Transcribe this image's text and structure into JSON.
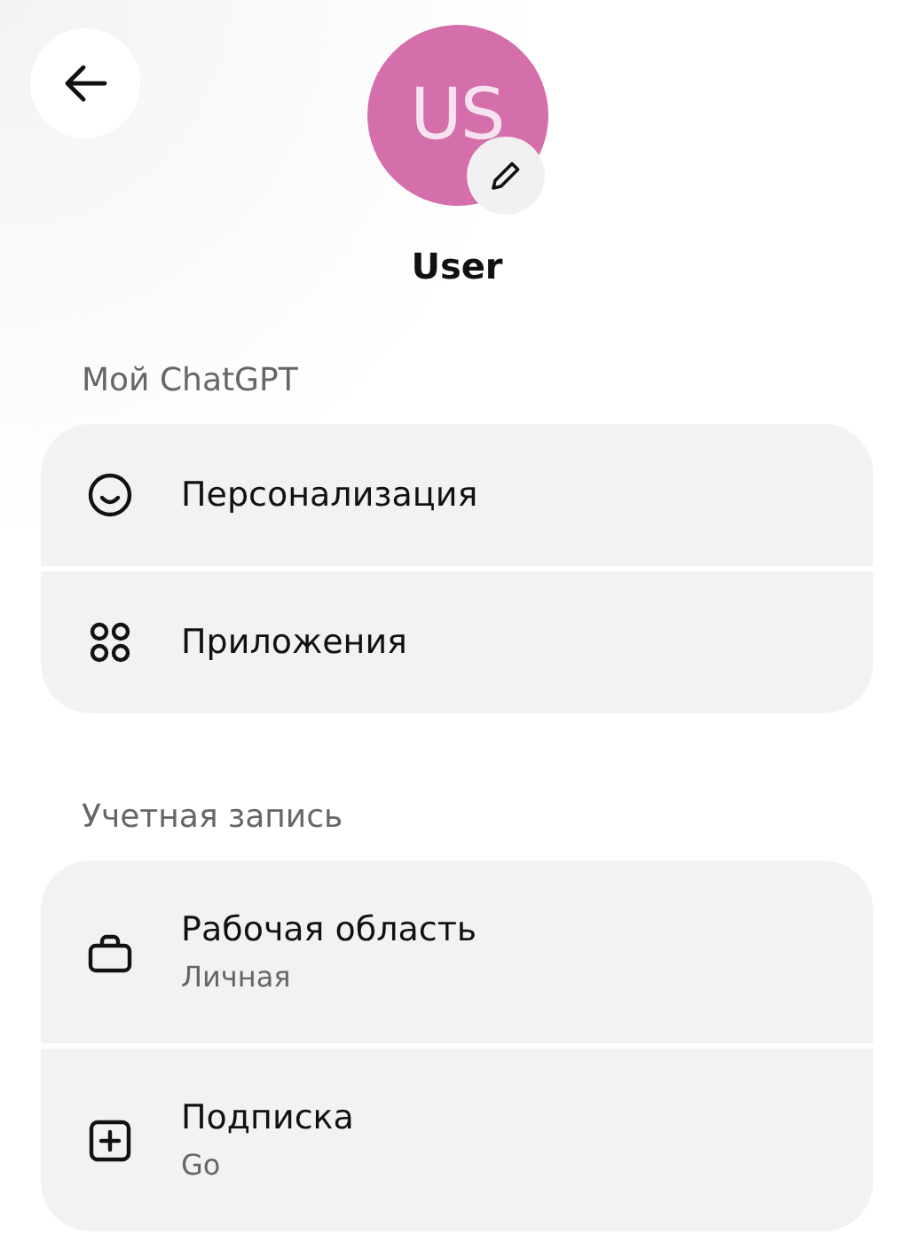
{
  "profile": {
    "initials": "US",
    "color": "#d56fab",
    "name": "User"
  },
  "sections": [
    {
      "title": "Мой ChatGPT",
      "items": [
        {
          "kind": "smile",
          "label": "Персонализация"
        },
        {
          "kind": "apps",
          "label": "Приложения"
        }
      ]
    },
    {
      "title": "Учетная запись",
      "items": [
        {
          "kind": "briefcase",
          "label": "Рабочая область",
          "subtitle": "Личная"
        },
        {
          "kind": "plus",
          "label": "Подписка",
          "subtitle": "Go"
        }
      ]
    }
  ]
}
